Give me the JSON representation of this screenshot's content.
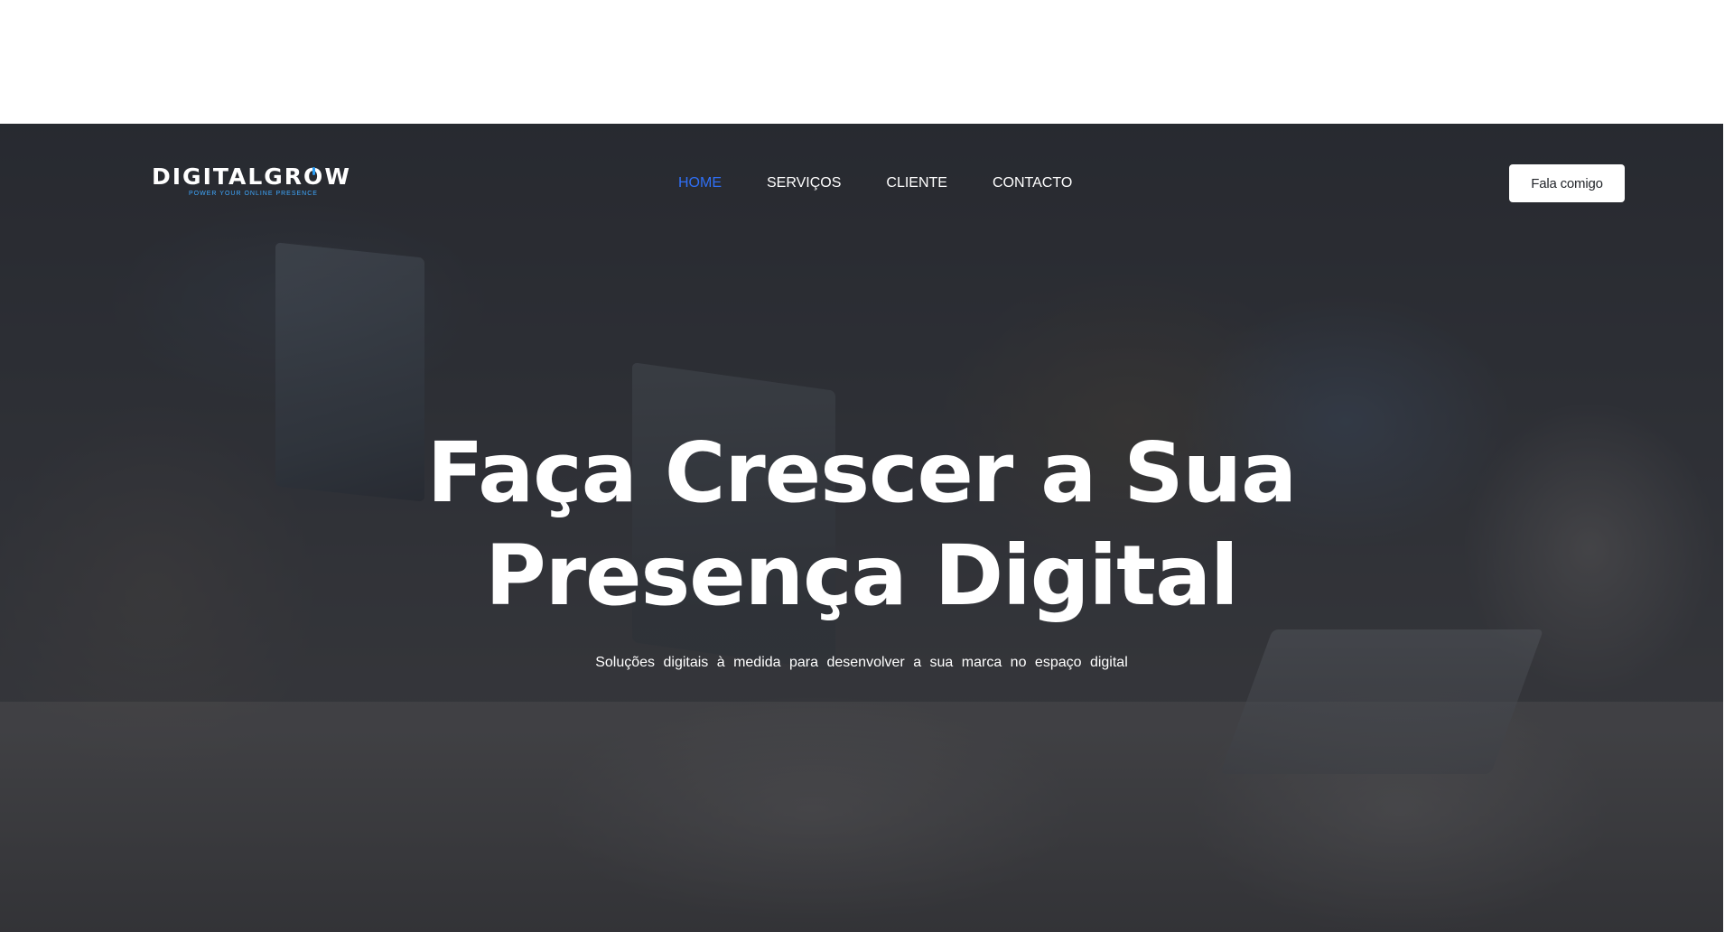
{
  "brand": {
    "logo_text_before": "DIGITALGR",
    "logo_text_o": "O",
    "logo_text_after": "W",
    "tagline": "POWER YOUR ONLINE PRESENCE",
    "accent_color": "#2a9df4"
  },
  "nav": {
    "items": [
      {
        "label": "HOME",
        "active": true
      },
      {
        "label": "SERVIÇOS",
        "active": false
      },
      {
        "label": "CLIENTE",
        "active": false
      },
      {
        "label": "CONTACTO",
        "active": false
      }
    ],
    "active_color": "#2f6ff5",
    "cta_label": "Fala comigo"
  },
  "hero": {
    "title_line1": "Faça Crescer a Sua",
    "title_line2": "Presença Digital",
    "subtitle": "Soluções digitais à medida para desenvolver a sua marca no espaço digital",
    "background": "photo of people working at computers in an office, darkened overlay"
  }
}
